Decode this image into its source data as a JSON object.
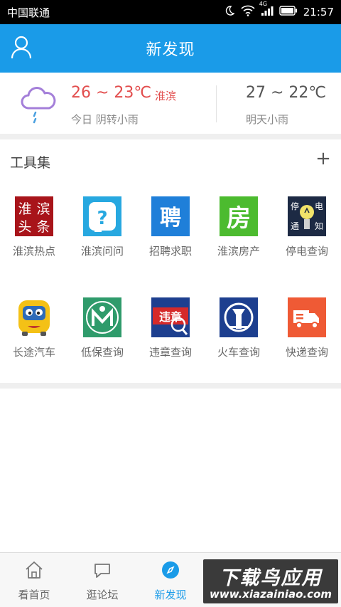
{
  "status_bar": {
    "carrier": "中国联通",
    "network": "4G",
    "time": "21:57"
  },
  "header": {
    "title": "新发现",
    "user_icon": "user-icon"
  },
  "weather": {
    "icon": "cloud-rain-icon",
    "today_temp": "26 ~ 23℃",
    "city": "淮滨",
    "today_desc": "今日 阴转小雨",
    "tomorrow_temp": "27 ~ 22℃",
    "tomorrow_desc": "明天小雨"
  },
  "tools": {
    "title": "工具集",
    "add_symbol": "+",
    "items": [
      {
        "label": "淮滨热点",
        "icon": "huaibin-news-icon",
        "icon_text": [
          "淮",
          "滨",
          "头",
          "条"
        ]
      },
      {
        "label": "淮滨问问",
        "icon": "question-icon"
      },
      {
        "label": "招聘求职",
        "icon": "recruit-icon",
        "icon_text": "聘"
      },
      {
        "label": "淮滨房产",
        "icon": "house-icon",
        "icon_text": "房"
      },
      {
        "label": "停电查询",
        "icon": "power-outage-icon",
        "icon_text": [
          "停",
          "电",
          "通",
          "知"
        ]
      },
      {
        "label": "长途汽车",
        "icon": "bus-icon"
      },
      {
        "label": "低保查询",
        "icon": "welfare-icon"
      },
      {
        "label": "违章查询",
        "icon": "violation-icon",
        "icon_text": "违章"
      },
      {
        "label": "火车查询",
        "icon": "train-icon"
      },
      {
        "label": "快递查询",
        "icon": "delivery-truck-icon"
      }
    ]
  },
  "tabbar": {
    "tabs": [
      {
        "label": "看首页",
        "icon": "home-icon",
        "active": false
      },
      {
        "label": "逛论坛",
        "icon": "chat-icon",
        "active": false
      },
      {
        "label": "新发现",
        "icon": "compass-icon",
        "active": true
      }
    ]
  },
  "watermark": {
    "line1": "下载鸟应用",
    "line2": "www.xiazainiao.com"
  },
  "colors": {
    "primary": "#1a9be8",
    "temp_red": "#e24d4d",
    "rain_cloud": "#a47fd9"
  }
}
